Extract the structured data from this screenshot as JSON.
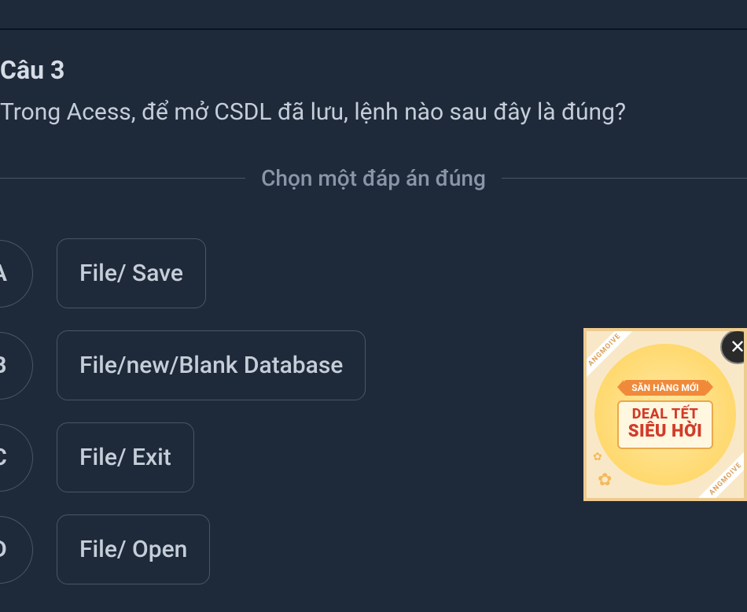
{
  "question": {
    "number_label": "Câu 3",
    "text": "Trong Acess, để mở CSDL đã lưu, lệnh nào sau đây là đúng?"
  },
  "instruction": "Chọn một đáp án đúng",
  "answers": [
    {
      "letter": "A",
      "text": "File/ Save"
    },
    {
      "letter": "B",
      "text": "File/new/Blank Database"
    },
    {
      "letter": "C",
      "text": "File/ Exit"
    },
    {
      "letter": "D",
      "text": "File/ Open"
    }
  ],
  "ad": {
    "ribbon": "SĂN HÀNG MỚI",
    "line1": "DEAL TẾT",
    "line2": "SIÊU HỜI",
    "diag_text": "ANGMOIVE",
    "close_glyph": "✕"
  }
}
